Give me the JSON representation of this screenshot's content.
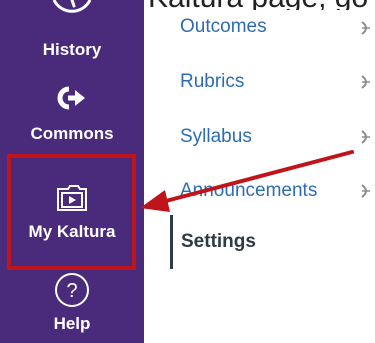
{
  "caption": {
    "text": "Kaltura page, go to My"
  },
  "global_nav": {
    "items": [
      {
        "id": "history",
        "label": "History",
        "icon": "clock-icon"
      },
      {
        "id": "commons",
        "label": "Commons",
        "icon": "commons-arrow-icon"
      },
      {
        "id": "mykaltura",
        "label": "My Kaltura",
        "icon": "folder-play-icon"
      },
      {
        "id": "help",
        "label": "Help",
        "icon": "question-circle-icon"
      }
    ]
  },
  "course_nav": {
    "links": [
      {
        "label": "Outcomes"
      },
      {
        "label": "Rubrics"
      },
      {
        "label": "Syllabus"
      },
      {
        "label": "Announcements"
      }
    ],
    "settings_label": "Settings"
  },
  "colors": {
    "nav_background": "#4a2a7a",
    "link": "#2d6cb5",
    "highlight": "#c0141b"
  }
}
